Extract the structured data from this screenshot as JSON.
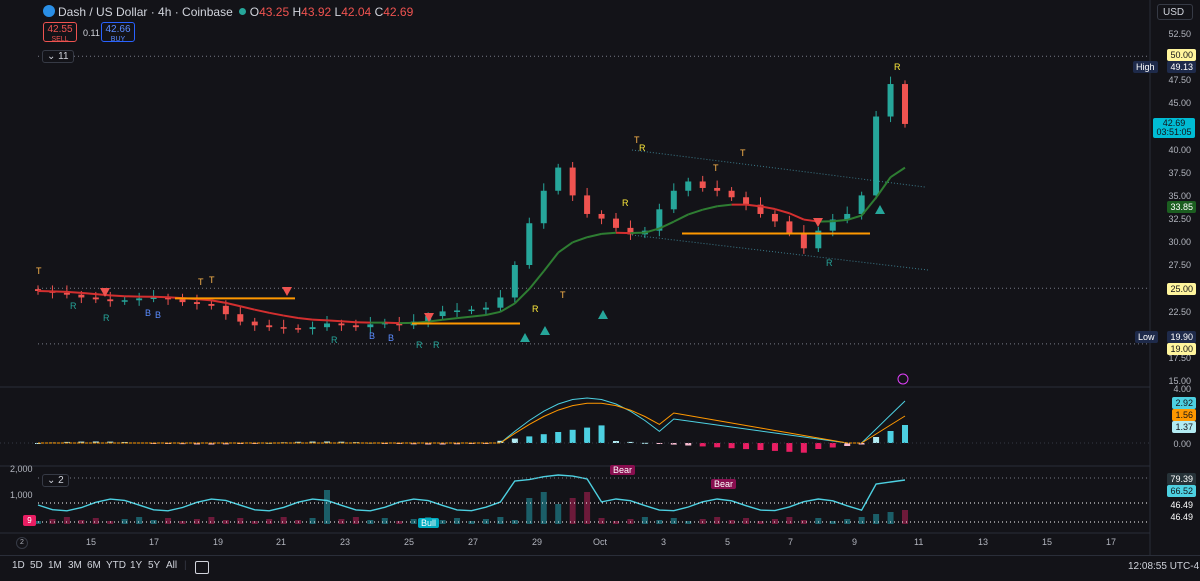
{
  "header": {
    "title": "Dash / US Dollar · 4h · Coinbase",
    "o_label": "O",
    "o": "43.25",
    "h_label": "H",
    "h": "43.92",
    "l_label": "L",
    "l": "42.04",
    "c_label": "C",
    "c": "42.69",
    "sell_price": "42.55",
    "sell_label": "SELL",
    "spread": "0.11",
    "buy_price": "42.66",
    "buy_label": "BUY",
    "indicators_count": "11",
    "currency": "USD"
  },
  "price_axis": {
    "ticks": [
      "52.50",
      "47.50",
      "45.00",
      "40.00",
      "37.50",
      "35.00",
      "32.50",
      "30.00",
      "27.50",
      "22.50",
      "17.50",
      "15.00"
    ],
    "labels": {
      "alert_50": "50.00",
      "high_label": "High",
      "high": "49.13",
      "last": "42.69",
      "countdown": "03:51:05",
      "ma": "33.85",
      "alert_25": "25.00",
      "low_label": "Low",
      "low": "19.90",
      "alert_19": "19.00"
    }
  },
  "macd_axis": {
    "top": "4.00",
    "v1": "2.92",
    "v2": "1.56",
    "v3": "1.37",
    "zero": "0.00"
  },
  "vol_pane": {
    "collapse": "2",
    "left_top": "2,000",
    "left_mid": "1,000",
    "badge": "9",
    "labels": {
      "v1": "79.39",
      "v2": "66.52",
      "v3": "46.49",
      "v4": "46.49"
    },
    "bear1": "Bear",
    "bear2": "Bear",
    "bull": "Bull"
  },
  "time_axis": [
    "15",
    "17",
    "19",
    "21",
    "23",
    "25",
    "27",
    "29",
    "Oct",
    "3",
    "5",
    "7",
    "9",
    "11",
    "13",
    "15",
    "17"
  ],
  "bottom": {
    "ranges": [
      "1D",
      "5D",
      "1M",
      "3M",
      "6M",
      "YTD",
      "1Y",
      "5Y",
      "All"
    ],
    "clock": "12:08:55 UTC-4",
    "scale_num": "2"
  },
  "chart_data": {
    "type": "candlestick",
    "symbol": "Dash / US Dollar",
    "interval": "4h",
    "exchange": "Coinbase",
    "ylim": [
      15,
      52.5
    ],
    "closes": [
      24.7,
      24.5,
      24.3,
      24.0,
      23.8,
      23.6,
      23.7,
      23.9,
      24.0,
      23.8,
      23.5,
      23.3,
      23.1,
      22.2,
      21.4,
      21.0,
      20.8,
      20.7,
      20.6,
      20.8,
      21.2,
      21.0,
      20.8,
      21.1,
      21.3,
      21.0,
      21.4,
      22.0,
      22.5,
      22.6,
      22.7,
      22.9,
      24.0,
      27.5,
      32.0,
      35.5,
      38.0,
      35.0,
      33.0,
      32.5,
      31.5,
      30.8,
      31.2,
      33.5,
      35.5,
      36.5,
      35.8,
      35.5,
      34.8,
      34.0,
      33.0,
      32.2,
      31.0,
      29.3,
      31.2,
      32.4,
      33.0,
      35.0,
      43.5,
      47.0,
      42.7
    ],
    "annotations": {
      "high": 49.13,
      "low": 19.9,
      "alerts": [
        50.0,
        25.0,
        19.0
      ],
      "horizontal_levels": [
        25.0,
        19.0,
        50.0
      ]
    },
    "macd_values": [
      2.92,
      1.56,
      1.37
    ],
    "rsi_values": [
      79.39,
      66.52,
      46.49,
      46.49
    ],
    "colors": {
      "up": "#26a69a",
      "down": "#ef5350",
      "ma_red": "#d32f2f",
      "ma_green": "#2e7d32",
      "orange": "#ff9800",
      "cyan": "#4dd0e1"
    }
  }
}
